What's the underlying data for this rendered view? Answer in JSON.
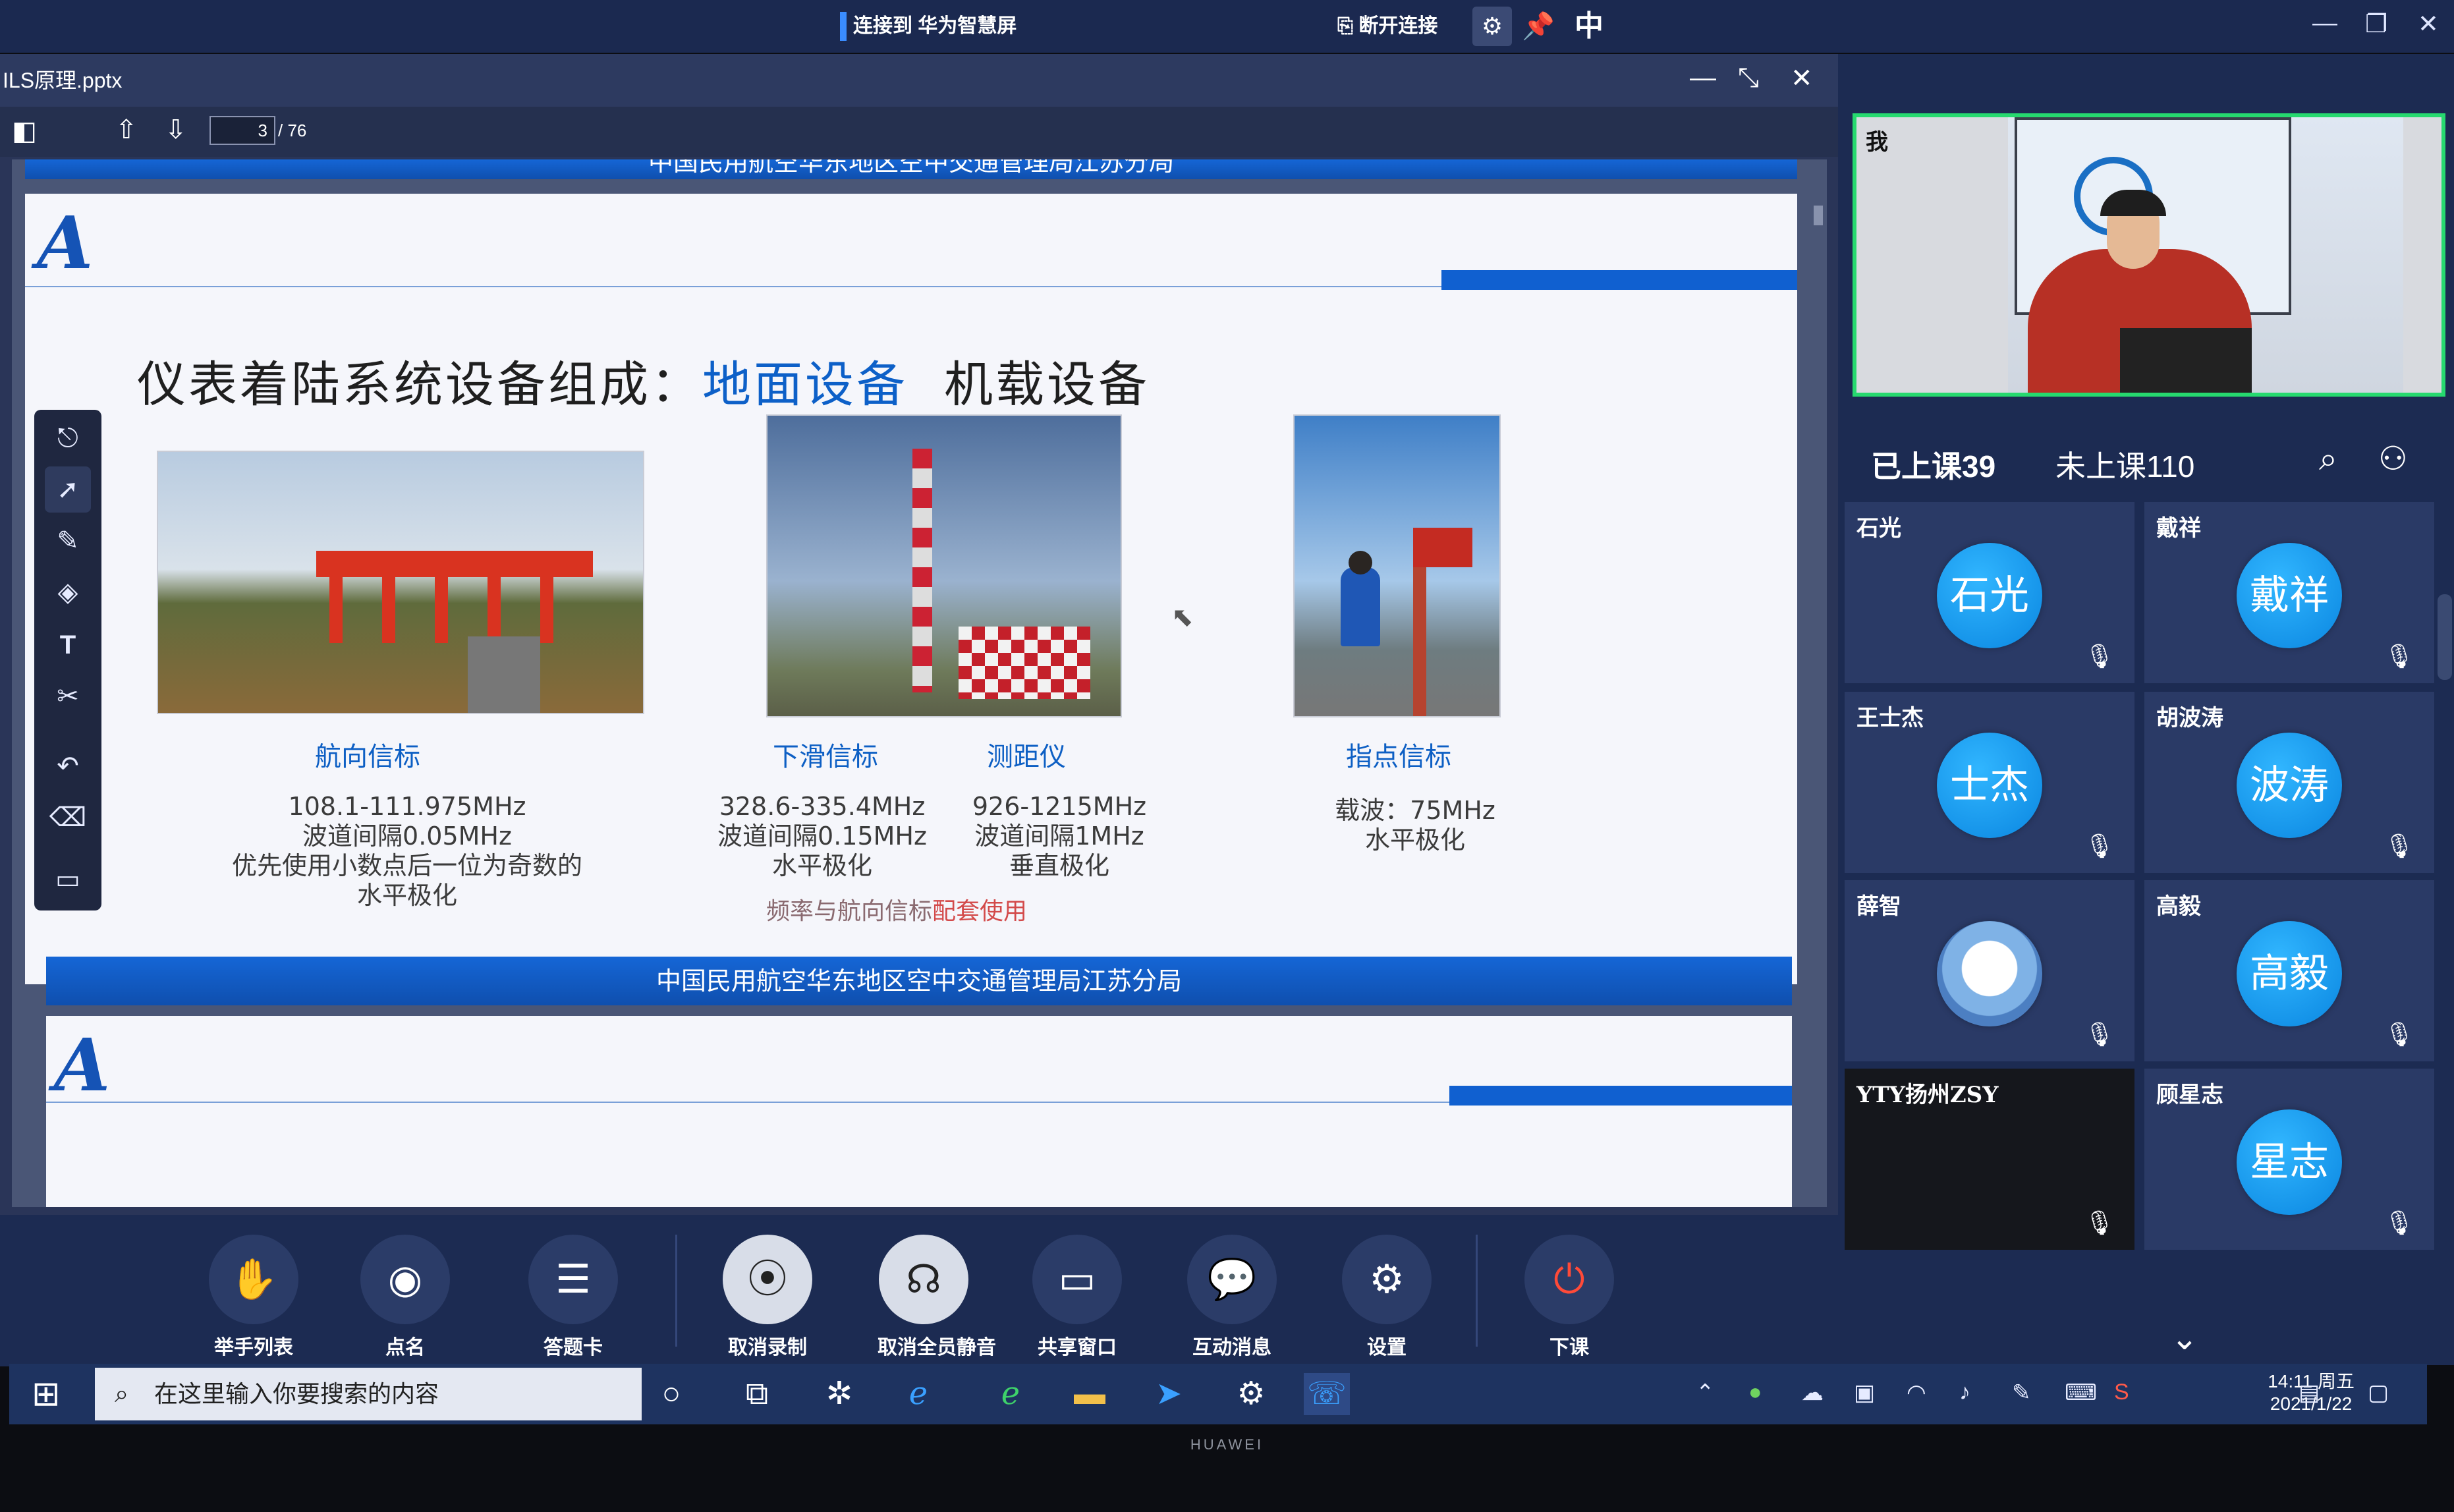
{
  "projection": {
    "title": "连接到 华为智慧屏",
    "disconnect_label": "断开连接",
    "ime_label": "中"
  },
  "ppt": {
    "filename": "ILS原理.pptx",
    "page_current": "3",
    "page_total": "/ 76"
  },
  "slide": {
    "top_band_text": "中国民用航空华东地区空中交通管理局江苏分局",
    "title_prefix": "仪表着陆系统设备组成：",
    "title_highlight": "地面设备",
    "title_suffix": "机载设备",
    "items": [
      {
        "caption": "航向信标",
        "specs": [
          "108.1-111.975MHz",
          "波道间隔0.05MHz",
          "优先使用小数点后一位为奇数的",
          "水平极化"
        ]
      },
      {
        "caption": "下滑信标",
        "specs": [
          "328.6-335.4MHz",
          "波道间隔0.15MHz",
          "水平极化"
        ]
      },
      {
        "caption": "测距仪",
        "specs": [
          "926-1215MHz",
          "波道间隔1MHz",
          "垂直极化"
        ]
      },
      {
        "caption": "指点信标",
        "specs": [
          "载波：75MHz",
          "水平极化"
        ]
      }
    ],
    "note_prefix": "频率与航向信标",
    "note_red": "配套使用",
    "bottom_band_text": "中国民用航空华东地区空中交通管理局江苏分局"
  },
  "participants": {
    "self_label": "我",
    "attended": "已上课39",
    "not_attended": "未上课110",
    "tiles": [
      {
        "name": "石光",
        "avatar": "石光"
      },
      {
        "name": "戴祥",
        "avatar": "戴祥"
      },
      {
        "name": "王士杰",
        "avatar": "士杰"
      },
      {
        "name": "胡波涛",
        "avatar": "波涛"
      },
      {
        "name": "薛智",
        "avatar": ""
      },
      {
        "name": "高毅",
        "avatar": "高毅"
      },
      {
        "name": "YTY扬州ZSY",
        "avatar": ""
      },
      {
        "name": "顾星志",
        "avatar": "星志"
      }
    ]
  },
  "controls": [
    {
      "label": "举手列表",
      "icon": "hand-icon"
    },
    {
      "label": "点名",
      "icon": "roll-call-icon"
    },
    {
      "label": "答题卡",
      "icon": "answer-card-icon"
    },
    {
      "label": "取消录制",
      "icon": "record-icon"
    },
    {
      "label": "取消全员静音",
      "icon": "mute-all-icon"
    },
    {
      "label": "共享窗口",
      "icon": "share-window-icon"
    },
    {
      "label": "互动消息",
      "icon": "chat-icon"
    },
    {
      "label": "设置",
      "icon": "settings-icon"
    },
    {
      "label": "下课",
      "icon": "power-icon"
    }
  ],
  "taskbar": {
    "search_placeholder": "在这里输入你要搜索的内容",
    "time": "14:11 周五",
    "date": "2021/1/22"
  },
  "brand": "HUAWEI",
  "colors": {
    "accent": "#0d60c8",
    "panel_bg": "#1c2b52",
    "active_video_border": "#26d96f",
    "avatar_blue": "#0a86e0"
  }
}
